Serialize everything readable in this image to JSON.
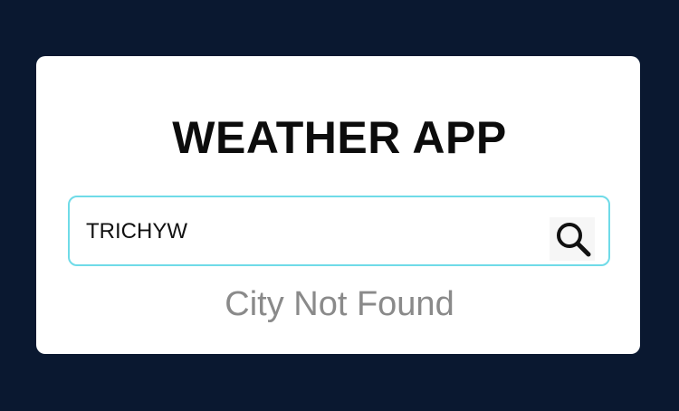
{
  "app": {
    "title": "WEATHER APP"
  },
  "search": {
    "value": "TRICHYW",
    "placeholder": "",
    "button_icon": "search-icon"
  },
  "status": {
    "message": "City Not Found"
  },
  "colors": {
    "background": "#0a1830",
    "card": "#ffffff",
    "input_border": "#6fdbe8",
    "title_text": "#0c0c0c",
    "status_text": "#8a8a8a"
  }
}
